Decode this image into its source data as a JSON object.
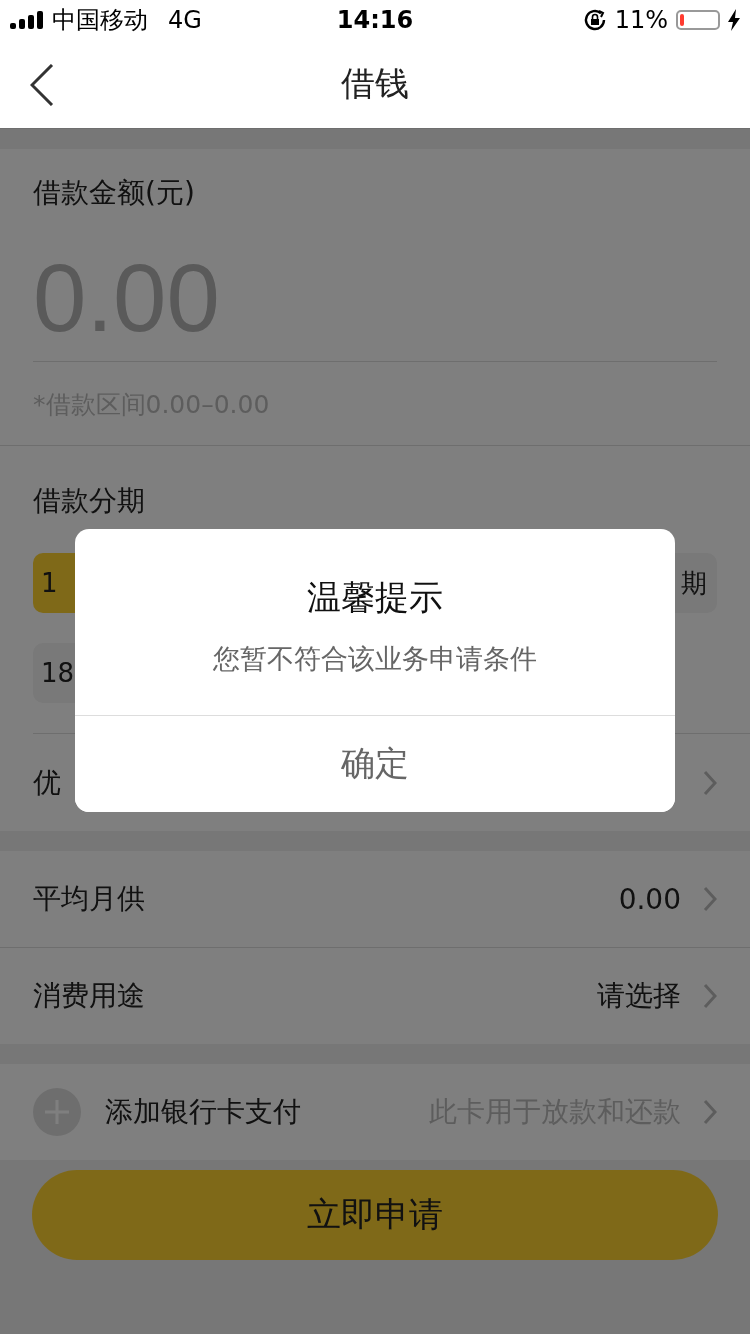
{
  "status_bar": {
    "carrier": "中国移动",
    "network": "4G",
    "time": "14:16",
    "battery_percent": "11%",
    "battery": {
      "level": 0.11,
      "charging": true
    }
  },
  "nav": {
    "title": "借钱"
  },
  "amount": {
    "label": "借款金额(元)",
    "placeholder": "0.00",
    "range_hint": "*借款区间0.00–0.00"
  },
  "installments": {
    "label": "借款分期",
    "chips": [
      {
        "text": "1",
        "selected": true
      },
      {
        "text": "期",
        "selected": false
      },
      {
        "text": "18",
        "selected": false
      }
    ],
    "discount_row": {
      "label": "优"
    }
  },
  "rows": [
    {
      "label": "平均月供",
      "value": "0.00"
    },
    {
      "label": "消费用途",
      "value": "请选择"
    }
  ],
  "bank_card": {
    "label": "添加银行卡支付",
    "hint": "此卡用于放款和还款"
  },
  "submit_button": "立即申请",
  "dialog": {
    "title": "温馨提示",
    "message": "您暂不符合该业务申请条件",
    "button": "确定"
  }
}
